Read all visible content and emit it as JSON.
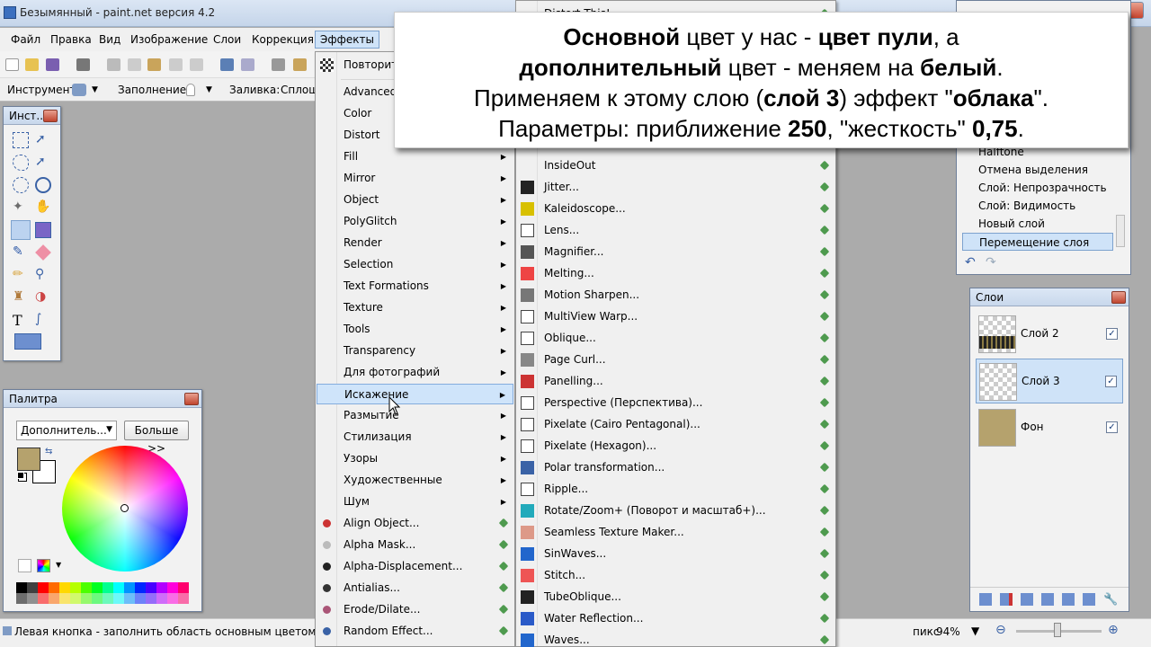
{
  "window": {
    "title": "Безымянный - paint.net версия 4.2"
  },
  "menubar": [
    "Файл",
    "Правка",
    "Вид",
    "Изображение",
    "Слои",
    "Коррекция",
    "Эффекты"
  ],
  "options": {
    "tool_label": "Инструмент:",
    "fill_label": "Заполнение:",
    "flood_label": "Заливка:",
    "flood_value": "Сплош"
  },
  "toolbox": {
    "title": "Инст..."
  },
  "palette": {
    "title": "Палитра",
    "mode": "Дополнитель...",
    "more_button": "Больше >>",
    "primary_color": "#b5a26d",
    "swatches": [
      "#000000",
      "#404040",
      "#ff0000",
      "#ff6a00",
      "#ffd800",
      "#b6ff00",
      "#4cff00",
      "#00ff21",
      "#00ff90",
      "#00ffff",
      "#0094ff",
      "#0026ff",
      "#4800ff",
      "#b200ff",
      "#ff00dc",
      "#ff006e"
    ]
  },
  "effects_menu": {
    "repeat": "Повторить",
    "items": [
      "Advanced",
      "Color",
      "Distort",
      "Fill",
      "Mirror",
      "Object",
      "PolyGlitch",
      "Render",
      "Selection",
      "Text Formations",
      "Texture",
      "Tools",
      "Transparency",
      "Для фотографий",
      "Искажение",
      "Размытие",
      "Стилизация",
      "Узоры",
      "Художественные",
      "Шум",
      "Align Object...",
      "Alpha Mask...",
      "Alpha-Displacement...",
      "Antialias...",
      "Erode/Dilate...",
      "Random Effect..."
    ]
  },
  "distort_submenu": {
    "top_item": "Distort This!",
    "items": [
      "InsideOut",
      "Jitter...",
      "Kaleidoscope...",
      "Lens...",
      "Magnifier...",
      "Melting...",
      "Motion Sharpen...",
      "MultiView Warp...",
      "Oblique...",
      "Page Curl...",
      "Panelling...",
      "Perspective (Перспектива)...",
      "Pixelate (Cairo Pentagonal)...",
      "Pixelate (Hexagon)...",
      "Polar transformation...",
      "Ripple...",
      "Rotate/Zoom+ (Поворот и масштаб+)...",
      "Seamless Texture Maker...",
      "SinWaves...",
      "Stitch...",
      "TubeOblique...",
      "Water Reflection...",
      "Waves..."
    ]
  },
  "history": {
    "items": [
      "Halftone",
      "Отмена выделения",
      "Слой: Непрозрачность",
      "Слой: Видимость",
      "Новый слой",
      "Перемещение слоя"
    ]
  },
  "layers": {
    "title": "Слои",
    "items": [
      {
        "name": "Слой 2",
        "checked": "✓"
      },
      {
        "name": "Слой 3",
        "checked": "✓"
      },
      {
        "name": "Фон",
        "checked": "✓"
      }
    ]
  },
  "status": {
    "text": "Левая кнопка - заполнить область основным цветом, права",
    "units": "пикс",
    "zoom": "94%"
  },
  "overlay": {
    "l1a": "Основной",
    "l1b": " цвет у нас - ",
    "l1c": "цвет пули",
    "l1d": ", а",
    "l2a": "дополнительный",
    "l2b": " цвет - меняем на ",
    "l2c": "белый",
    "l2d": ".",
    "l3a": "Применяем к этому слою (",
    "l3b": "слой 3",
    "l3c": ") эффект \"",
    "l3d": "облака",
    "l3e": "\".",
    "l4a": "Параметры: приближение ",
    "l4b": "250",
    "l4c": ", \"жесткость\" ",
    "l4d": "0,75",
    "l4e": "."
  }
}
